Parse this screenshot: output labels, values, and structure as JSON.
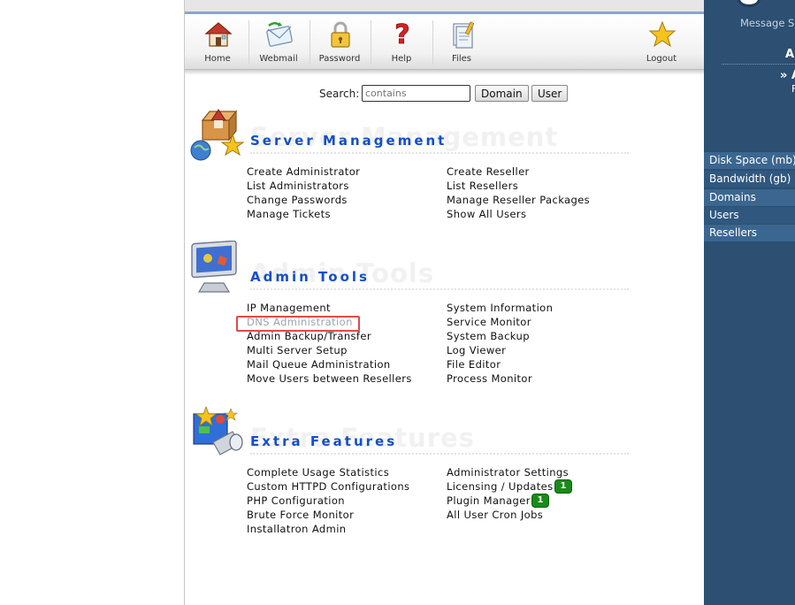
{
  "toolbar": {
    "items": [
      {
        "label": "Home",
        "icon": "home-icon"
      },
      {
        "label": "Webmail",
        "icon": "webmail-icon"
      },
      {
        "label": "Password",
        "icon": "lock-icon"
      },
      {
        "label": "Help",
        "icon": "help-icon"
      },
      {
        "label": "Files",
        "icon": "files-icon"
      },
      {
        "label": "Logout",
        "icon": "star-icon"
      }
    ]
  },
  "search": {
    "label": "Search:",
    "placeholder": "contains",
    "domain_button": "Domain",
    "user_button": "User"
  },
  "sections": {
    "server": {
      "title": "Server Management",
      "watermark": "Server Management",
      "left": [
        "Create Administrator",
        "List Administrators",
        "Change Passwords",
        "Manage Tickets"
      ],
      "right": [
        "Create Reseller",
        "List Resellers",
        "Manage Reseller Packages",
        "Show All Users"
      ]
    },
    "admin": {
      "title": "Admin Tools",
      "watermark": "Admin Tools",
      "left": [
        "IP Management",
        "DNS Administration",
        "Admin Backup/Transfer",
        "Multi Server Setup",
        "Mail Queue Administration",
        "Move Users between Resellers"
      ],
      "right": [
        "System Information",
        "Service Monitor",
        "System Backup",
        "Log Viewer",
        "File Editor",
        "Process Monitor"
      ]
    },
    "extra": {
      "title": "Extra Features",
      "watermark": "Extra Features",
      "left": [
        "Complete Usage Statistics",
        "Custom HTTPD Configurations",
        "PHP Configuration",
        "Brute Force Monitor",
        "Installatron Admin"
      ],
      "right": [
        "Administrator Settings",
        "Licensing / Updates",
        "Plugin Manager",
        "All User Cron Jobs"
      ],
      "badges": {
        "licensing": "1",
        "plugin": "1"
      }
    }
  },
  "right_panel": {
    "message": "Message S",
    "header_fragment": "A",
    "arrow_fragment": "» A",
    "sub_fragment": "F",
    "stats": [
      "Disk Space (mb)",
      "Bandwidth (gb)",
      "Domains",
      "Users",
      "Resellers"
    ]
  },
  "colors": {
    "title_blue": "#1450c8",
    "panel_navy": "#2c4f72",
    "badge_green": "#1a8a1a",
    "highlight_red": "#e24a4a"
  }
}
